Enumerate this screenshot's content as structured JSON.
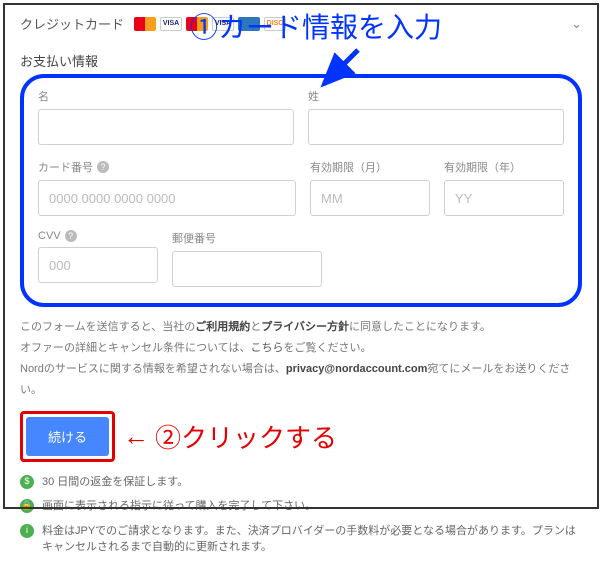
{
  "header": {
    "label": "クレジットカード"
  },
  "section_title": "お支払い情報",
  "annotations": {
    "step1": "①カード情報を入力",
    "step2": "②クリックする"
  },
  "fields": {
    "first_name": {
      "label": "名",
      "placeholder": ""
    },
    "last_name": {
      "label": "姓",
      "placeholder": ""
    },
    "card_number": {
      "label": "カード番号",
      "placeholder": "0000 0000 0000 0000"
    },
    "exp_month": {
      "label": "有効期限（月）",
      "placeholder": "MM"
    },
    "exp_year": {
      "label": "有効期限（年）",
      "placeholder": "YY"
    },
    "cvv": {
      "label": "CVV",
      "placeholder": "000"
    },
    "postal": {
      "label": "郵便番号",
      "placeholder": ""
    }
  },
  "legal": {
    "line1_a": "このフォームを送信すると、当社の",
    "line1_terms": "ご利用規約",
    "line1_and": "と",
    "line1_privacy": "プライバシー方針",
    "line1_b": "に同意したことになります。",
    "line2_a": "オファーの詳細とキャンセル条件については、",
    "line2_link": "こちら",
    "line2_b": "をご覧ください。",
    "line3_a": "Nordのサービスに関する情報を希望されない場合は、",
    "line3_email": "privacy@nordaccount.com",
    "line3_b": "宛てにメールをお送りください。"
  },
  "button": {
    "continue": "続ける"
  },
  "notes": {
    "n1": "30 日間の返金を保証します。",
    "n2": "画面に表示される指示に従って購入を完了して下さい。",
    "n3": "料金はJPYでのご請求となります。また、決済プロバイダーの手数料が必要となる場合があります。プランはキャンセルされるまで自動的に更新されます。"
  }
}
